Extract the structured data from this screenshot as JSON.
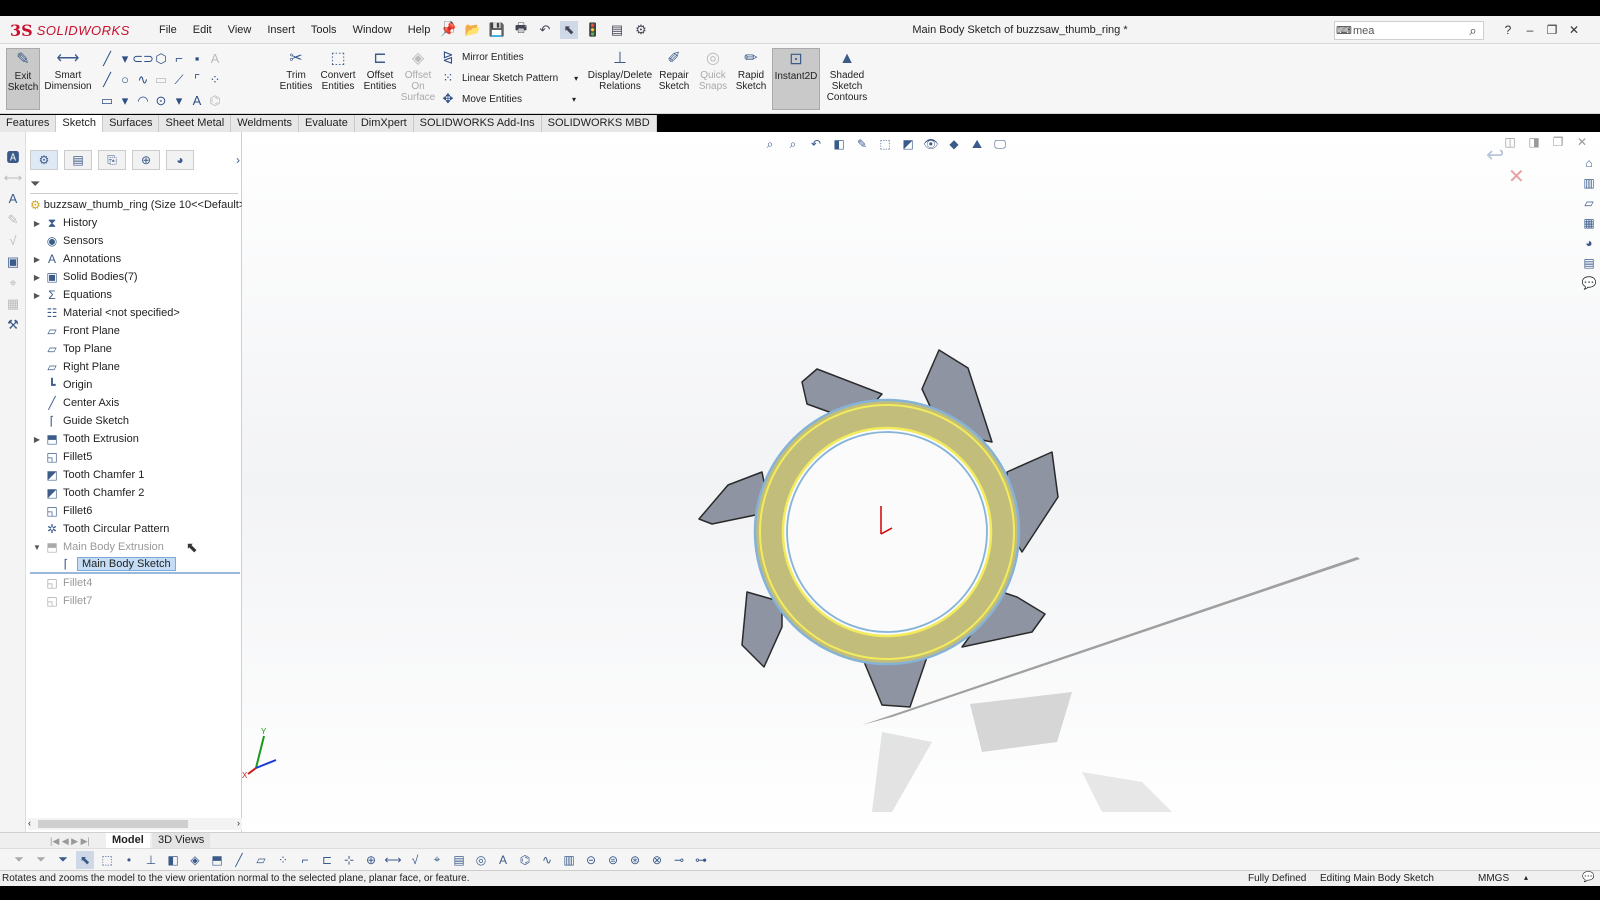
{
  "app": {
    "logo_ds": "3S",
    "logo_text": "SOLIDWORKS"
  },
  "menus": [
    "File",
    "Edit",
    "View",
    "Insert",
    "Tools",
    "Window",
    "Help"
  ],
  "document_title": "Main Body Sketch of buzzsaw_thumb_ring *",
  "search": {
    "value": "mea"
  },
  "command_manager": {
    "exit_sketch": "Exit Sketch",
    "smart_dimension": "Smart Dimension",
    "trim_entities": "Trim Entities",
    "convert_entities": "Convert Entities",
    "offset_entities": "Offset Entities",
    "offset_on_surface": "Offset On Surface",
    "mirror_entities": "Mirror Entities",
    "linear_sketch_pattern": "Linear Sketch Pattern",
    "move_entities": "Move Entities",
    "display_delete_relations": "Display/Delete Relations",
    "repair_sketch": "Repair Sketch",
    "quick_snaps": "Quick Snaps",
    "rapid_sketch": "Rapid Sketch",
    "instant2d": "Instant2D",
    "shaded_sketch_contours": "Shaded Sketch Contours"
  },
  "tabs": [
    "Features",
    "Sketch",
    "Surfaces",
    "Sheet Metal",
    "Weldments",
    "Evaluate",
    "DimXpert",
    "SOLIDWORKS Add-Ins",
    "SOLIDWORKS MBD"
  ],
  "active_tab": "Sketch",
  "tree": {
    "root": "buzzsaw_thumb_ring  (Size 10<<Default>_Di",
    "items": [
      {
        "label": "History"
      },
      {
        "label": "Sensors"
      },
      {
        "label": "Annotations"
      },
      {
        "label": "Solid Bodies(7)"
      },
      {
        "label": "Equations"
      },
      {
        "label": "Material <not specified>"
      },
      {
        "label": "Front Plane"
      },
      {
        "label": "Top Plane"
      },
      {
        "label": "Right Plane"
      },
      {
        "label": "Origin"
      },
      {
        "label": "Center Axis"
      },
      {
        "label": "Guide Sketch"
      },
      {
        "label": "Tooth Extrusion"
      },
      {
        "label": "Fillet5"
      },
      {
        "label": "Tooth Chamfer 1"
      },
      {
        "label": "Tooth Chamfer 2"
      },
      {
        "label": "Fillet6"
      },
      {
        "label": "Tooth Circular Pattern"
      },
      {
        "label": "Main Body Extrusion"
      },
      {
        "label": "Main Body Sketch"
      },
      {
        "label": "Fillet4"
      },
      {
        "label": "Fillet7"
      }
    ]
  },
  "bottom_tabs": [
    "Model",
    "3D Views"
  ],
  "status": {
    "message": "Rotates and zooms the model to the view orientation normal to the selected plane, planar face, or feature.",
    "definition": "Fully Defined",
    "mode": "Editing Main Body Sketch",
    "units": "MMGS"
  },
  "colors": {
    "accent": "#c8102e",
    "selection": "#c5dcf5",
    "ring": "#c9c27a",
    "teeth": "#8e93a3"
  }
}
